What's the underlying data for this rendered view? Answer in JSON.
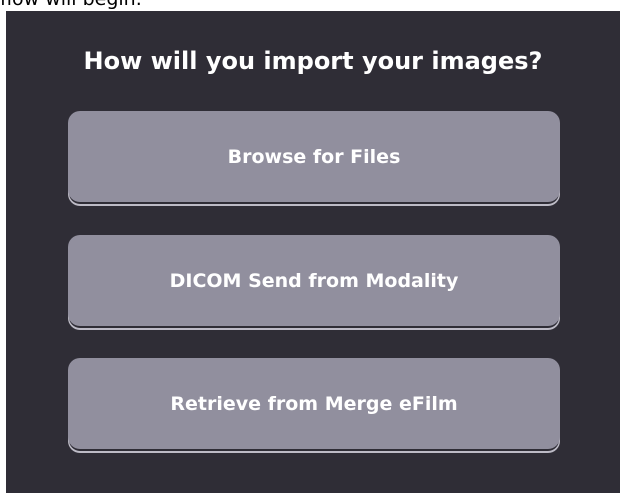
{
  "header_fragment": "flow will begin.",
  "dialog": {
    "title": "How will you import your images?",
    "buttons": {
      "browse": "Browse for Files",
      "dicom_send": "DICOM Send from Modality",
      "retrieve": "Retrieve from Merge eFilm"
    }
  }
}
